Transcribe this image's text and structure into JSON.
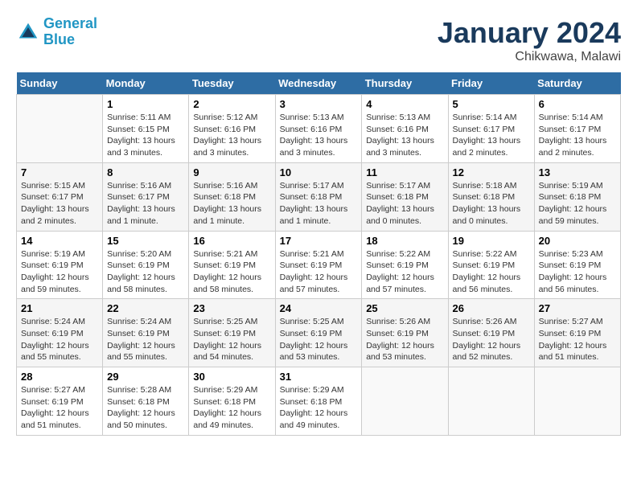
{
  "logo": {
    "line1": "General",
    "line2": "Blue"
  },
  "title": "January 2024",
  "subtitle": "Chikwawa, Malawi",
  "days_header": [
    "Sunday",
    "Monday",
    "Tuesday",
    "Wednesday",
    "Thursday",
    "Friday",
    "Saturday"
  ],
  "weeks": [
    [
      {
        "day": "",
        "sunrise": "",
        "sunset": "",
        "daylight": ""
      },
      {
        "day": "1",
        "sunrise": "Sunrise: 5:11 AM",
        "sunset": "Sunset: 6:15 PM",
        "daylight": "Daylight: 13 hours and 3 minutes."
      },
      {
        "day": "2",
        "sunrise": "Sunrise: 5:12 AM",
        "sunset": "Sunset: 6:16 PM",
        "daylight": "Daylight: 13 hours and 3 minutes."
      },
      {
        "day": "3",
        "sunrise": "Sunrise: 5:13 AM",
        "sunset": "Sunset: 6:16 PM",
        "daylight": "Daylight: 13 hours and 3 minutes."
      },
      {
        "day": "4",
        "sunrise": "Sunrise: 5:13 AM",
        "sunset": "Sunset: 6:16 PM",
        "daylight": "Daylight: 13 hours and 3 minutes."
      },
      {
        "day": "5",
        "sunrise": "Sunrise: 5:14 AM",
        "sunset": "Sunset: 6:17 PM",
        "daylight": "Daylight: 13 hours and 2 minutes."
      },
      {
        "day": "6",
        "sunrise": "Sunrise: 5:14 AM",
        "sunset": "Sunset: 6:17 PM",
        "daylight": "Daylight: 13 hours and 2 minutes."
      }
    ],
    [
      {
        "day": "7",
        "sunrise": "Sunrise: 5:15 AM",
        "sunset": "Sunset: 6:17 PM",
        "daylight": "Daylight: 13 hours and 2 minutes."
      },
      {
        "day": "8",
        "sunrise": "Sunrise: 5:16 AM",
        "sunset": "Sunset: 6:17 PM",
        "daylight": "Daylight: 13 hours and 1 minute."
      },
      {
        "day": "9",
        "sunrise": "Sunrise: 5:16 AM",
        "sunset": "Sunset: 6:18 PM",
        "daylight": "Daylight: 13 hours and 1 minute."
      },
      {
        "day": "10",
        "sunrise": "Sunrise: 5:17 AM",
        "sunset": "Sunset: 6:18 PM",
        "daylight": "Daylight: 13 hours and 1 minute."
      },
      {
        "day": "11",
        "sunrise": "Sunrise: 5:17 AM",
        "sunset": "Sunset: 6:18 PM",
        "daylight": "Daylight: 13 hours and 0 minutes."
      },
      {
        "day": "12",
        "sunrise": "Sunrise: 5:18 AM",
        "sunset": "Sunset: 6:18 PM",
        "daylight": "Daylight: 13 hours and 0 minutes."
      },
      {
        "day": "13",
        "sunrise": "Sunrise: 5:19 AM",
        "sunset": "Sunset: 6:18 PM",
        "daylight": "Daylight: 12 hours and 59 minutes."
      }
    ],
    [
      {
        "day": "14",
        "sunrise": "Sunrise: 5:19 AM",
        "sunset": "Sunset: 6:19 PM",
        "daylight": "Daylight: 12 hours and 59 minutes."
      },
      {
        "day": "15",
        "sunrise": "Sunrise: 5:20 AM",
        "sunset": "Sunset: 6:19 PM",
        "daylight": "Daylight: 12 hours and 58 minutes."
      },
      {
        "day": "16",
        "sunrise": "Sunrise: 5:21 AM",
        "sunset": "Sunset: 6:19 PM",
        "daylight": "Daylight: 12 hours and 58 minutes."
      },
      {
        "day": "17",
        "sunrise": "Sunrise: 5:21 AM",
        "sunset": "Sunset: 6:19 PM",
        "daylight": "Daylight: 12 hours and 57 minutes."
      },
      {
        "day": "18",
        "sunrise": "Sunrise: 5:22 AM",
        "sunset": "Sunset: 6:19 PM",
        "daylight": "Daylight: 12 hours and 57 minutes."
      },
      {
        "day": "19",
        "sunrise": "Sunrise: 5:22 AM",
        "sunset": "Sunset: 6:19 PM",
        "daylight": "Daylight: 12 hours and 56 minutes."
      },
      {
        "day": "20",
        "sunrise": "Sunrise: 5:23 AM",
        "sunset": "Sunset: 6:19 PM",
        "daylight": "Daylight: 12 hours and 56 minutes."
      }
    ],
    [
      {
        "day": "21",
        "sunrise": "Sunrise: 5:24 AM",
        "sunset": "Sunset: 6:19 PM",
        "daylight": "Daylight: 12 hours and 55 minutes."
      },
      {
        "day": "22",
        "sunrise": "Sunrise: 5:24 AM",
        "sunset": "Sunset: 6:19 PM",
        "daylight": "Daylight: 12 hours and 55 minutes."
      },
      {
        "day": "23",
        "sunrise": "Sunrise: 5:25 AM",
        "sunset": "Sunset: 6:19 PM",
        "daylight": "Daylight: 12 hours and 54 minutes."
      },
      {
        "day": "24",
        "sunrise": "Sunrise: 5:25 AM",
        "sunset": "Sunset: 6:19 PM",
        "daylight": "Daylight: 12 hours and 53 minutes."
      },
      {
        "day": "25",
        "sunrise": "Sunrise: 5:26 AM",
        "sunset": "Sunset: 6:19 PM",
        "daylight": "Daylight: 12 hours and 53 minutes."
      },
      {
        "day": "26",
        "sunrise": "Sunrise: 5:26 AM",
        "sunset": "Sunset: 6:19 PM",
        "daylight": "Daylight: 12 hours and 52 minutes."
      },
      {
        "day": "27",
        "sunrise": "Sunrise: 5:27 AM",
        "sunset": "Sunset: 6:19 PM",
        "daylight": "Daylight: 12 hours and 51 minutes."
      }
    ],
    [
      {
        "day": "28",
        "sunrise": "Sunrise: 5:27 AM",
        "sunset": "Sunset: 6:19 PM",
        "daylight": "Daylight: 12 hours and 51 minutes."
      },
      {
        "day": "29",
        "sunrise": "Sunrise: 5:28 AM",
        "sunset": "Sunset: 6:18 PM",
        "daylight": "Daylight: 12 hours and 50 minutes."
      },
      {
        "day": "30",
        "sunrise": "Sunrise: 5:29 AM",
        "sunset": "Sunset: 6:18 PM",
        "daylight": "Daylight: 12 hours and 49 minutes."
      },
      {
        "day": "31",
        "sunrise": "Sunrise: 5:29 AM",
        "sunset": "Sunset: 6:18 PM",
        "daylight": "Daylight: 12 hours and 49 minutes."
      },
      {
        "day": "",
        "sunrise": "",
        "sunset": "",
        "daylight": ""
      },
      {
        "day": "",
        "sunrise": "",
        "sunset": "",
        "daylight": ""
      },
      {
        "day": "",
        "sunrise": "",
        "sunset": "",
        "daylight": ""
      }
    ]
  ]
}
